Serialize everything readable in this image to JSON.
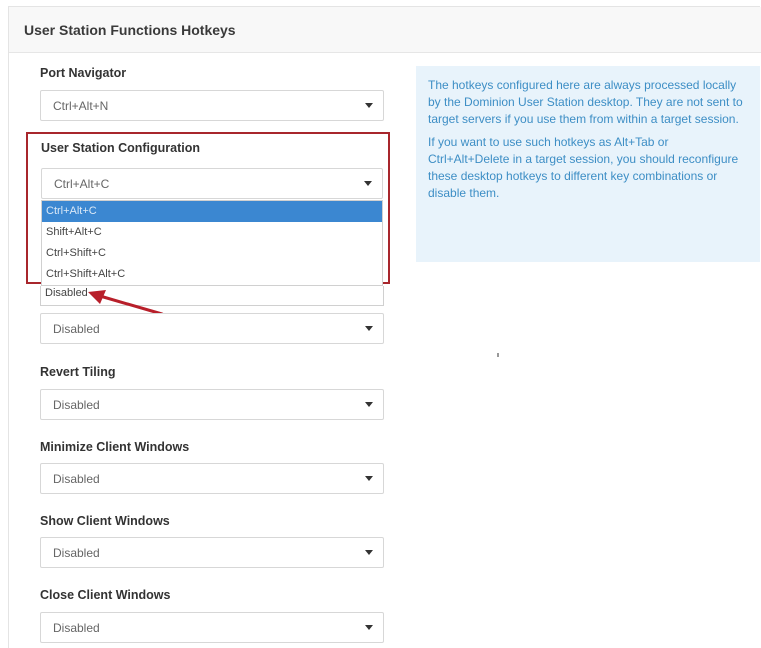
{
  "panel": {
    "title": "User Station Functions Hotkeys"
  },
  "port_navigator": {
    "label": "Port Navigator",
    "value": "Ctrl+Alt+N"
  },
  "user_station_configuration": {
    "label": "User Station Configuration",
    "value": "Ctrl+Alt+C",
    "options": [
      "Ctrl+Alt+C",
      "Shift+Alt+C",
      "Ctrl+Shift+C",
      "Ctrl+Shift+Alt+C"
    ],
    "partial_option": "Disabled"
  },
  "unlabeled_select": {
    "value": "Disabled"
  },
  "revert_tiling": {
    "label": "Revert Tiling",
    "value": "Disabled"
  },
  "minimize_client_windows": {
    "label": "Minimize Client Windows",
    "value": "Disabled"
  },
  "show_client_windows": {
    "label": "Show Client Windows",
    "value": "Disabled"
  },
  "close_client_windows": {
    "label": "Close Client Windows",
    "value": "Disabled"
  },
  "info": {
    "paragraph_1": "The hotkeys configured here are always processed locally by the Dominion User Station desktop. They are not sent to target servers if you use them from within a target session.",
    "paragraph_2": "If you want to use such hotkeys as Alt+Tab or Ctrl+Alt+Delete in a target session, you should reconfigure these desktop hotkeys to different key combinations or disable them."
  },
  "colors": {
    "highlight_border": "#a8262c",
    "selected_option": "#3b87d1",
    "info_text": "#3d8ec5",
    "info_background": "#e8f3fb"
  },
  "icons": {
    "select_caret": "caret-down-icon",
    "annotation": "red-arrow-icon"
  }
}
